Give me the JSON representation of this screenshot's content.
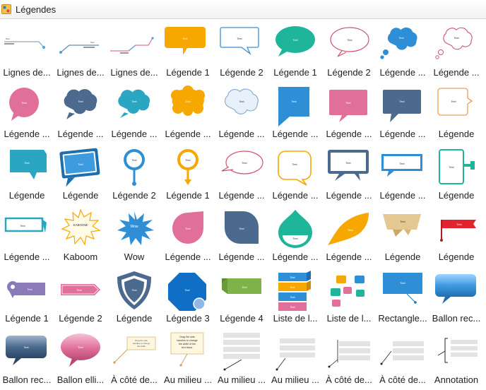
{
  "header": {
    "title": "Légendes",
    "icon": "shapes-library-icon"
  },
  "items": [
    {
      "label": "Lignes de...",
      "icon": "line-callout-1"
    },
    {
      "label": "Lignes de...",
      "icon": "line-callout-2"
    },
    {
      "label": "Lignes de...",
      "icon": "line-callout-3"
    },
    {
      "label": "Légende 1",
      "icon": "rect-bubble-orange"
    },
    {
      "label": "Légende 2",
      "icon": "rect-bubble-outline-blue"
    },
    {
      "label": "Légende 1",
      "icon": "oval-bubble-teal"
    },
    {
      "label": "Légende 2",
      "icon": "oval-bubble-outline-pink"
    },
    {
      "label": "Légende ...",
      "icon": "cloud-thought-blue"
    },
    {
      "label": "Légende ...",
      "icon": "cloud-thought-outline-pink"
    },
    {
      "label": "Légende ...",
      "icon": "round-bubble-pink"
    },
    {
      "label": "Légende ...",
      "icon": "cloud-navy"
    },
    {
      "label": "Légende ...",
      "icon": "cloud-teal"
    },
    {
      "label": "Légende ...",
      "icon": "cloud-orange"
    },
    {
      "label": "Légende ...",
      "icon": "cloud-light-blue"
    },
    {
      "label": "Légende ...",
      "icon": "flag-bubble-blue"
    },
    {
      "label": "Légende ...",
      "icon": "square-bubble-pink"
    },
    {
      "label": "Légende ...",
      "icon": "square-bubble-navy"
    },
    {
      "label": "Légende",
      "icon": "rect-bubble-outline-orange"
    },
    {
      "label": "Légende",
      "icon": "trapezoid-bubble-teal"
    },
    {
      "label": "Légende",
      "icon": "tilted-bubble-blue"
    },
    {
      "label": "Légende 2",
      "icon": "pin-bubble-blue"
    },
    {
      "label": "Légende 1",
      "icon": "pin-bubble-orange"
    },
    {
      "label": "Légende ...",
      "icon": "oval-bubble-outline-pink-2"
    },
    {
      "label": "Légende ...",
      "icon": "round-bubble-outline-yellow"
    },
    {
      "label": "Légende ...",
      "icon": "rect-bubble-navy-frame"
    },
    {
      "label": "Légende ...",
      "icon": "rect-bubble-blue-frame"
    },
    {
      "label": "Légende",
      "icon": "phone-bubble-teal"
    },
    {
      "label": "Légende ...",
      "icon": "arrow-box-teal"
    },
    {
      "label": "Kaboom",
      "icon": "kaboom-burst"
    },
    {
      "label": "Wow",
      "icon": "wow-burst"
    },
    {
      "label": "Légende ...",
      "icon": "drop-bubble-pink"
    },
    {
      "label": "Légende ...",
      "icon": "leaf-bubble-navy"
    },
    {
      "label": "Légende ...",
      "icon": "drop-bubble-green"
    },
    {
      "label": "Légende ...",
      "icon": "leaf-bubble-yellow"
    },
    {
      "label": "Légende",
      "icon": "ribbon-beige"
    },
    {
      "label": "Légende",
      "icon": "flag-red"
    },
    {
      "label": "Légende 1",
      "icon": "pin-label-purple"
    },
    {
      "label": "Légende 2",
      "icon": "arrow-label-pink"
    },
    {
      "label": "Légende",
      "icon": "shield-navy"
    },
    {
      "label": "Légende 3",
      "icon": "octagon-blue"
    },
    {
      "label": "Légende 4",
      "icon": "banner-green"
    },
    {
      "label": "Liste de l...",
      "icon": "stacked-list"
    },
    {
      "label": "Liste de l...",
      "icon": "small-bubbles-list"
    },
    {
      "label": "Rectangle...",
      "icon": "rect-callout-blue"
    },
    {
      "label": "Ballon rec...",
      "icon": "glossy-rect-blue"
    },
    {
      "label": "Ballon rec...",
      "icon": "glossy-rect-navy"
    },
    {
      "label": "Ballon elli...",
      "icon": "glossy-oval-pink"
    },
    {
      "label": "À côté de...",
      "icon": "side-text-block-1"
    },
    {
      "label": "Au milieu ...",
      "icon": "middle-text-block-1"
    },
    {
      "label": "Au milieu ...",
      "icon": "middle-lines-1"
    },
    {
      "label": "Au milieu ...",
      "icon": "middle-lines-2"
    },
    {
      "label": "À côté de...",
      "icon": "side-lines-1"
    },
    {
      "label": "À côté de...",
      "icon": "side-lines-2"
    },
    {
      "label": "Annotation",
      "icon": "annotation-bracket"
    }
  ],
  "thumb_text": {
    "text": "Text",
    "kaboom": "KABOOM!",
    "wow": "Wow",
    "drag_hint": "Drag the side handles to change the width of the text block."
  },
  "colors": {
    "orange": "#f7a800",
    "teal": "#1fb59a",
    "pink": "#e0709a",
    "navy": "#4b6a8e",
    "blue": "#2f8fd6",
    "lightblue": "#e6f0fa",
    "green": "#7fb34a",
    "red": "#e2232d",
    "purple": "#8a7ab8",
    "beige": "#e3c892"
  }
}
